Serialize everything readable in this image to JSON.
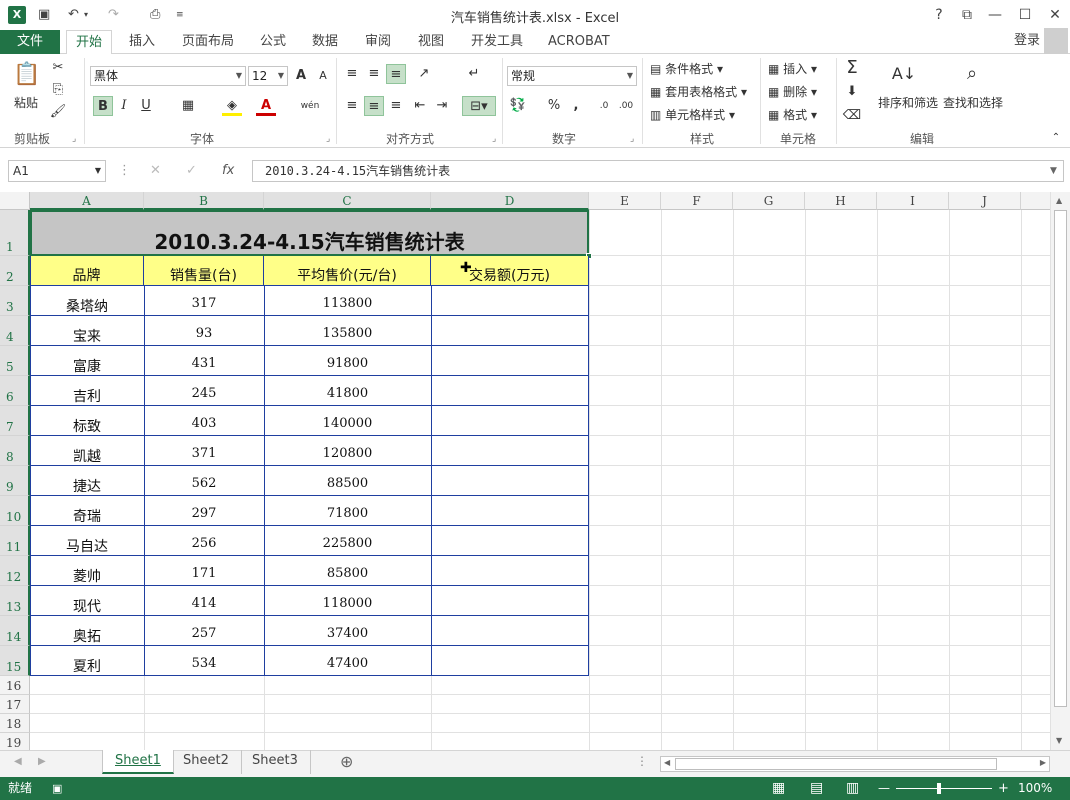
{
  "window": {
    "title": "汽车销售统计表.xlsx - Excel",
    "app_icon": "X",
    "controls": [
      "?",
      "⧉",
      "—",
      "☐",
      "✕"
    ]
  },
  "quick_access": {
    "save": "💾",
    "undo": "↶",
    "redo": "↷",
    "preview": "🔍"
  },
  "tabs": {
    "file": "文件",
    "items": [
      "开始",
      "插入",
      "页面布局",
      "公式",
      "数据",
      "审阅",
      "视图",
      "开发工具",
      "ACROBAT"
    ],
    "login": "登录"
  },
  "ribbon": {
    "clipboard": {
      "paste": "粘贴",
      "label": "剪贴板"
    },
    "font": {
      "name": "黑体",
      "size": "12",
      "bold": "B",
      "italic": "I",
      "underline": "U",
      "label": "字体",
      "grow": "A",
      "shrink": "A",
      "color_a": "A",
      "wen": "wén"
    },
    "align": {
      "label": "对齐方式"
    },
    "number": {
      "format": "常规",
      "label": "数字",
      "percent": "%",
      "comma": ","
    },
    "styles": {
      "cond": "条件格式",
      "table": "套用表格格式",
      "cell": "单元格样式",
      "label": "样式"
    },
    "cells": {
      "insert": "插入",
      "delete": "删除",
      "format": "格式",
      "label": "单元格"
    },
    "edit": {
      "sort": "排序和筛选",
      "find": "查找和选择",
      "label": "编辑"
    }
  },
  "formula_bar": {
    "name_box": "A1",
    "cancel": "✕",
    "enter": "✓",
    "fx": "fx",
    "content": "2010.3.24-4.15汽车销售统计表"
  },
  "columns": [
    "A",
    "B",
    "C",
    "D",
    "E",
    "F",
    "G",
    "H",
    "I",
    "J"
  ],
  "rows": [
    "1",
    "2",
    "3",
    "4",
    "5",
    "6",
    "7",
    "8",
    "9",
    "10",
    "11",
    "12",
    "13",
    "14",
    "15",
    "16",
    "17",
    "18",
    "19"
  ],
  "sheet": {
    "title": "2010.3.24-4.15汽车销售统计表",
    "headers": [
      "品牌",
      "销售量(台)",
      "平均售价(元/台)",
      "交易额(万元)"
    ],
    "data": [
      [
        "桑塔纳",
        "317",
        "113800",
        ""
      ],
      [
        "宝来",
        "93",
        "135800",
        ""
      ],
      [
        "富康",
        "431",
        "91800",
        ""
      ],
      [
        "吉利",
        "245",
        "41800",
        ""
      ],
      [
        "标致",
        "403",
        "140000",
        ""
      ],
      [
        "凯越",
        "371",
        "120800",
        ""
      ],
      [
        "捷达",
        "562",
        "88500",
        ""
      ],
      [
        "奇瑞",
        "297",
        "71800",
        ""
      ],
      [
        "马自达",
        "256",
        "225800",
        ""
      ],
      [
        "菱帅",
        "171",
        "85800",
        ""
      ],
      [
        "现代",
        "414",
        "118000",
        ""
      ],
      [
        "奥拓",
        "257",
        "37400",
        ""
      ],
      [
        "夏利",
        "534",
        "47400",
        ""
      ]
    ]
  },
  "sheet_tabs": [
    "Sheet1",
    "Sheet2",
    "Sheet3"
  ],
  "add_sheet": "⊕",
  "status": {
    "ready": "就绪",
    "zoom": "100%"
  },
  "colors": {
    "accent": "#217346",
    "header_fill": "#ffff88",
    "title_fill": "#c5c5c5",
    "table_border": "#1f3fa0"
  }
}
